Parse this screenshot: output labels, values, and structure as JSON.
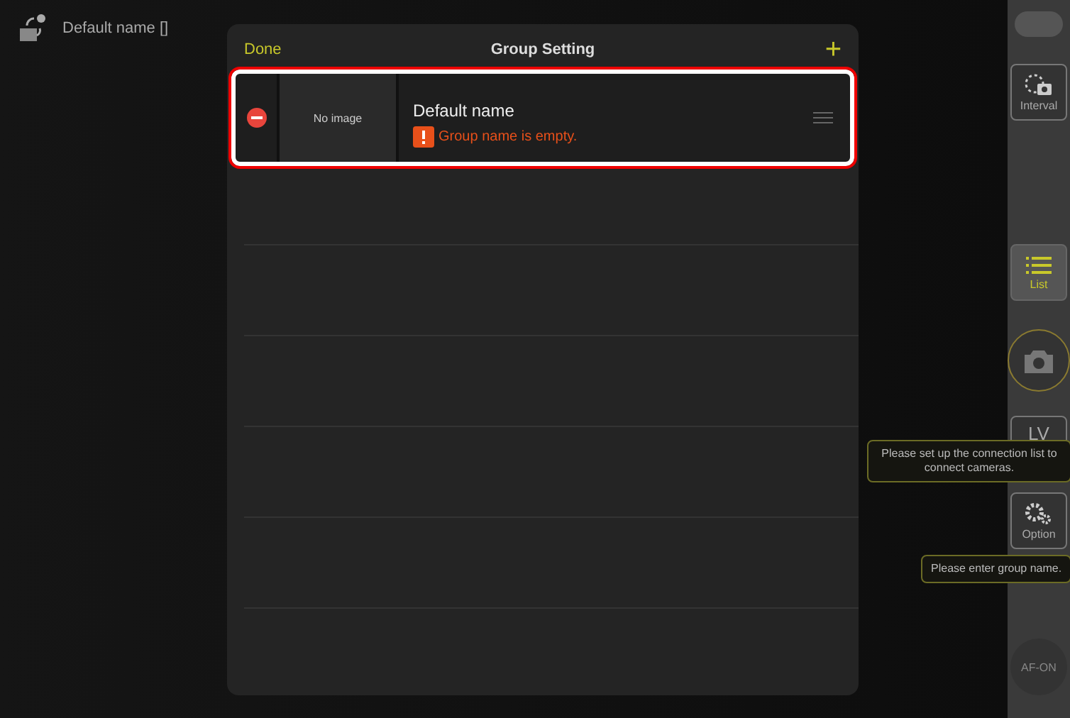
{
  "header": {
    "group_label": "Default name []"
  },
  "dialog": {
    "title": "Group Setting",
    "done": "Done",
    "add": "+",
    "groups": [
      {
        "name": "Default name",
        "thumbnail": "No image",
        "error": "Group name is empty.",
        "selected": true
      }
    ]
  },
  "sidebar": {
    "toggle_on": false,
    "items": [
      {
        "kind": "interval",
        "label": "Interval",
        "selected": false
      },
      {
        "kind": "spacer"
      },
      {
        "kind": "list",
        "label": "List",
        "selected": true
      },
      {
        "kind": "shutter"
      },
      {
        "kind": "liveview",
        "label": "LV",
        "selected": false
      },
      {
        "kind": "option",
        "label": "Option",
        "selected": false
      },
      {
        "kind": "spacer"
      },
      {
        "kind": "round",
        "label": "AF-ON"
      }
    ]
  },
  "tooltips": [
    "Please set up the connection list to connect cameras.",
    "Please enter group name."
  ]
}
